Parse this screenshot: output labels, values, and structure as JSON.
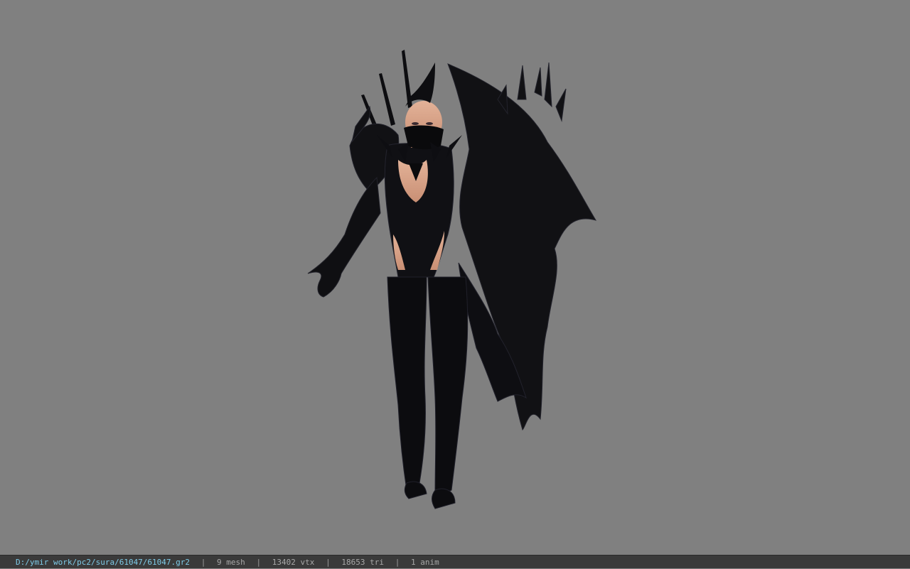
{
  "viewer": {
    "background_color": "#808080",
    "model_icon": "dark-armored-female-character-model"
  },
  "status_bar": {
    "file_path": "D:/ymir work/pc2/sura/61047/61047.gr2",
    "separator": "|",
    "mesh_count": "9 mesh",
    "vertex_count": "13402 vtx",
    "triangle_count": "18653 tri",
    "anim_count": "1 anim",
    "path_color": "#7ecbe8",
    "text_color": "#a8a8a8"
  }
}
